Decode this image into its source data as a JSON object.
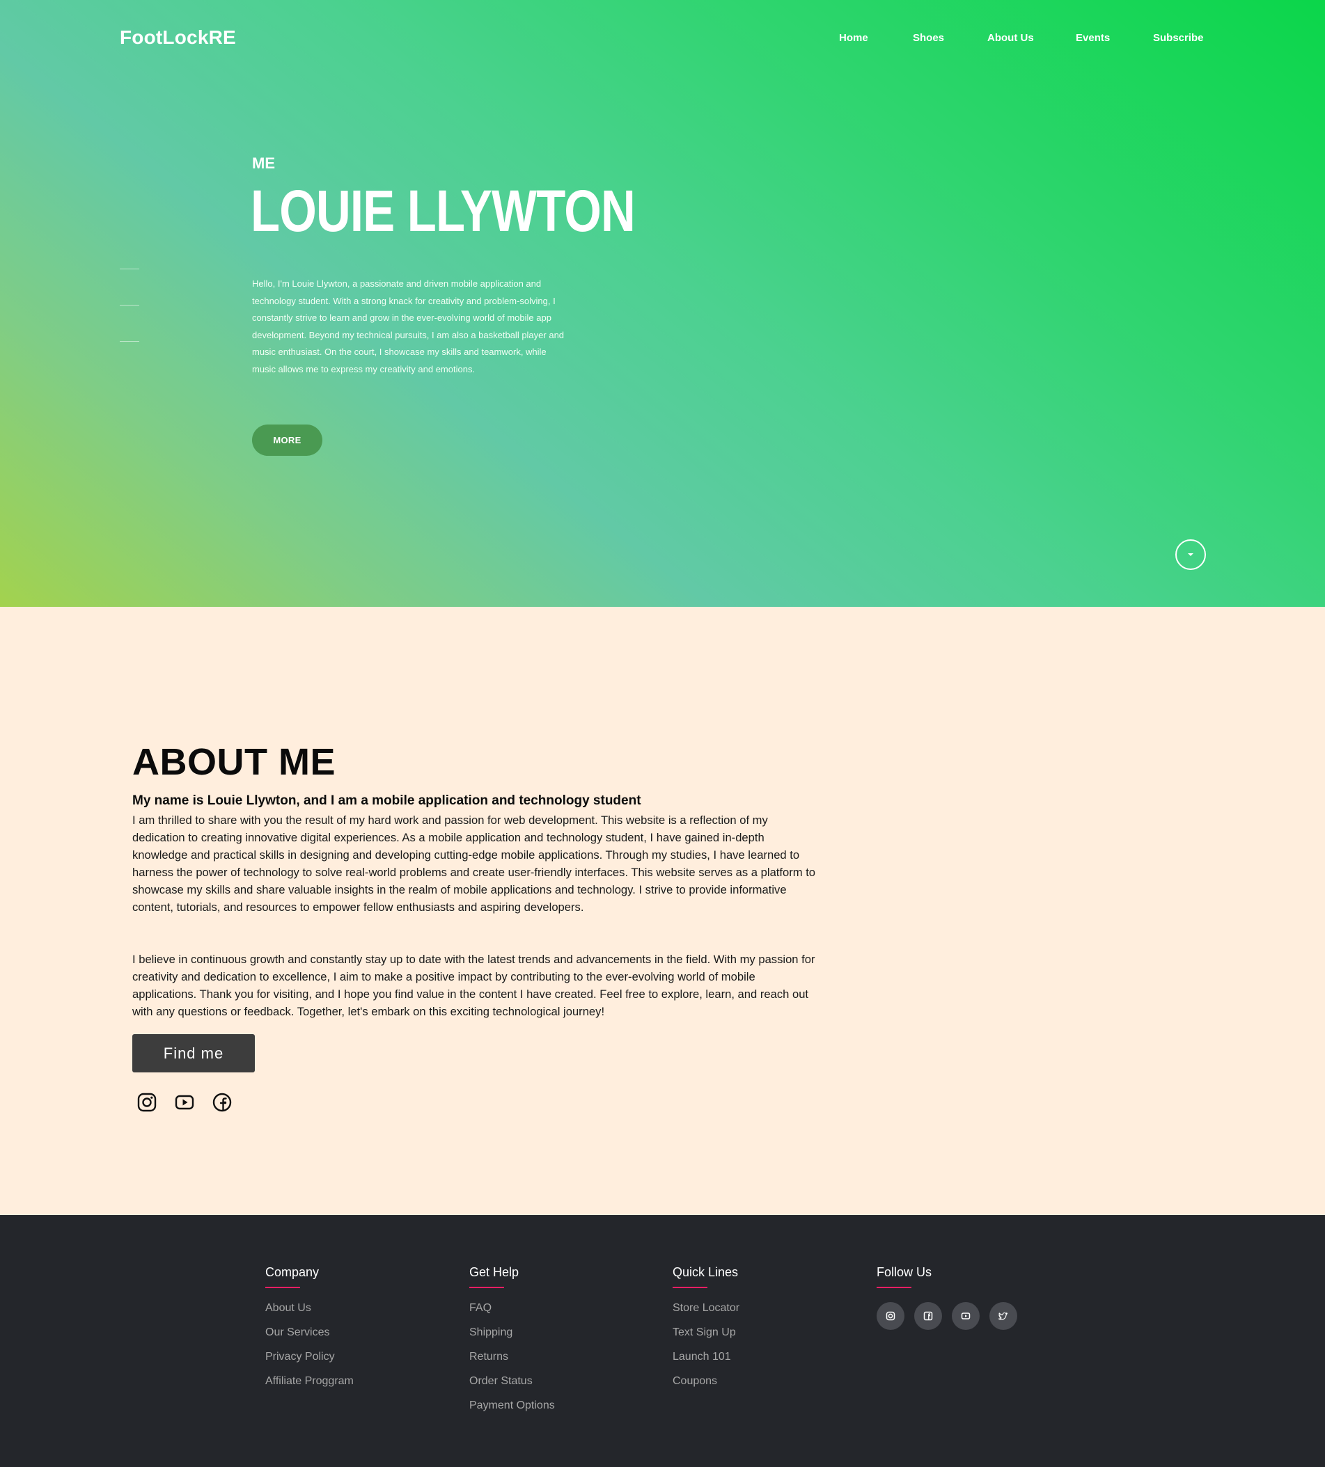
{
  "header": {
    "logo": "FootLockRE",
    "nav": [
      "Home",
      "Shoes",
      "About Us",
      "Events",
      "Subscribe"
    ]
  },
  "hero": {
    "kicker": "ME",
    "title": "LOUIE LLYWTON",
    "text": "Hello, I'm Louie Llywton, a passionate and driven mobile application and technology student. With a strong knack for creativity and problem-solving, I constantly strive to learn and grow in the ever-evolving world of mobile app development. Beyond my technical pursuits, I am also a basketball player and music enthusiast. On the court, I showcase my skills and teamwork, while music allows me to express my creativity and emotions.",
    "more_label": "MORE",
    "scroll_icon": "chevron-down-icon"
  },
  "about": {
    "title": "ABOUT ME",
    "subtitle": "My name is Louie Llywton, and I am a mobile application and technology student",
    "p1": "I am thrilled to share with you the result of my hard work and passion for web development. This website is a reflection of my dedication to creating innovative digital experiences. As a mobile application and technology student, I have gained in-depth knowledge and practical skills in designing and developing cutting-edge mobile applications. Through my studies, I have learned to harness the power of technology to solve real-world problems and create user-friendly interfaces. This website serves as a platform to showcase my skills and share valuable insights in the realm of mobile applications and technology. I strive to provide informative content, tutorials, and resources to empower fellow enthusiasts and aspiring developers.",
    "p2": "I believe in continuous growth and constantly stay up to date with the latest trends and advancements in the field. With my passion for creativity and dedication to excellence, I aim to make a positive impact by contributing to the ever-evolving world of mobile applications. Thank you for visiting, and I hope you find value in the content I have created. Feel free to explore, learn, and reach out with any questions or feedback. Together, let's embark on this exciting technological journey!",
    "find_label": "Find me",
    "social_icons": [
      "instagram-icon",
      "youtube-icon",
      "facebook-icon"
    ]
  },
  "footer": {
    "company": {
      "heading": "Company",
      "links": [
        "About Us",
        "Our Services",
        "Privacy Policy",
        "Affiliate Proggram"
      ]
    },
    "help": {
      "heading": "Get Help",
      "links": [
        "FAQ",
        "Shipping",
        "Returns",
        "Order Status",
        "Payment Options"
      ]
    },
    "quick": {
      "heading": "Quick Lines",
      "links": [
        "Store Locator",
        "Text Sign Up",
        "Launch 101",
        "Coupons"
      ]
    },
    "follow": {
      "heading": "Follow Us",
      "icons": [
        "instagram-icon",
        "facebook-icon",
        "youtube-icon",
        "twitter-icon"
      ]
    }
  },
  "colors": {
    "footer_bg": "#24262b",
    "accent_underline": "#e91e63",
    "about_bg": "#ffeedd",
    "more_button": "#4a9a52",
    "find_button": "#3d3d3d"
  }
}
